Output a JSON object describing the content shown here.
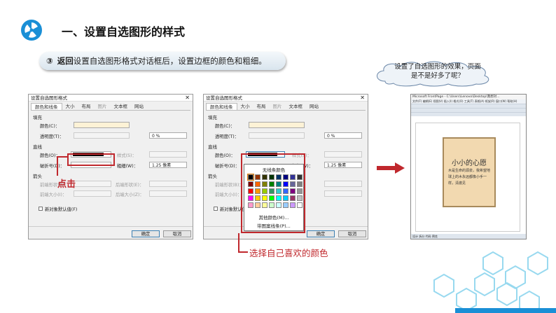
{
  "header": {
    "title": "一、设置自选图形的样式",
    "step": {
      "number": "③",
      "back": "返回",
      "text": "设置自选图形格式对话框后，设置边框的颜色和粗细。"
    },
    "cloud_text": "设置了自选图形的效果，页面是不是好多了呢？"
  },
  "dialog_left": {
    "title": "设置自选图形格式",
    "tabs": [
      "颜色和线条",
      "大小",
      "布局",
      "图片",
      "文本框",
      "网站"
    ],
    "fill_section": "填充",
    "color_label": "颜色(C)：",
    "transparency_label": "透明度(T)：",
    "transparency_value": "0 %",
    "line_section": "直线",
    "line_color_label": "颜色(O)：",
    "style_label": "样式(S)：",
    "dash_label": "破折号(D)：",
    "weight_label": "粗细(W)：",
    "weight_value": "1.25 像素",
    "arrows_section": "箭头",
    "begin_style_label": "前端形状(B)：",
    "end_style_label": "后端形状(E)：",
    "begin_size_label": "前端大小(I)：",
    "end_size_label": "后端大小(Z)：",
    "default_checkbox": "新对象默认值(F)",
    "ok": "确定",
    "cancel": "取消"
  },
  "dialog_right": {
    "title": "设置自选图形格式",
    "tabs": [
      "颜色和线条",
      "大小",
      "布局",
      "图片",
      "文本框",
      "网站"
    ],
    "fill_section": "填充",
    "color_label": "颜色(C)：",
    "transparency_label": "透明度(T)：",
    "transparency_value": "0 %",
    "line_section": "直线",
    "line_color_label": "颜色(O)：",
    "style_label": "样式(S)：",
    "dash_label": "破折号(D)：",
    "weight_label": "粗细(W)：",
    "weight_value": "1.25 像素",
    "arrows_section": "箭头",
    "begin_style_label": "前端形状(B)：",
    "begin_size_label": "前端大小(I)：",
    "default_checkbox": "新对象默认值(F)",
    "ok": "确定",
    "cancel": "取消",
    "palette": {
      "no_line": "无线条颜色",
      "more_colors": "其他颜色(M)...",
      "patterned": "带图案线条(P)..."
    }
  },
  "annotations": {
    "click": "点击",
    "choose_color": "选择自己喜欢的颜色"
  },
  "preview": {
    "window_title": "Microsoft FrontPage - C:\\Users\\Lenovo\\Desktop\\我想对...",
    "menu": "文件(F) 编辑(E) 视图(V) 插入(I) 格式(O) 工具(T) 表格(A) 框架(R) 窗口(W) 帮助(H)",
    "card_title": "小小的心愿",
    "card_body": "木是生命的源泉，我希望地球上的木永远都像小手一样，清澈见",
    "status_bar": "设计 拆分 代码 预览"
  },
  "colors": {
    "accent_red": "#c0282d",
    "logo_blue": "#1a8fd6",
    "arrow_red": "#c0282d"
  },
  "palette_swatches": [
    "#000000",
    "#993300",
    "#333300",
    "#003300",
    "#003366",
    "#000080",
    "#333399",
    "#333333",
    "#800000",
    "#ff6600",
    "#808000",
    "#008000",
    "#008080",
    "#0000ff",
    "#666699",
    "#808080",
    "#ff0000",
    "#ff9900",
    "#99cc00",
    "#339966",
    "#33cccc",
    "#3366ff",
    "#800080",
    "#969696",
    "#ff00ff",
    "#ffcc00",
    "#ffff00",
    "#00ff00",
    "#00ffff",
    "#00ccff",
    "#993366",
    "#c0c0c0",
    "#ff99cc",
    "#ffcc99",
    "#ffff99",
    "#ccffcc",
    "#ccffff",
    "#99ccff",
    "#cc99ff",
    "#ffffff"
  ]
}
